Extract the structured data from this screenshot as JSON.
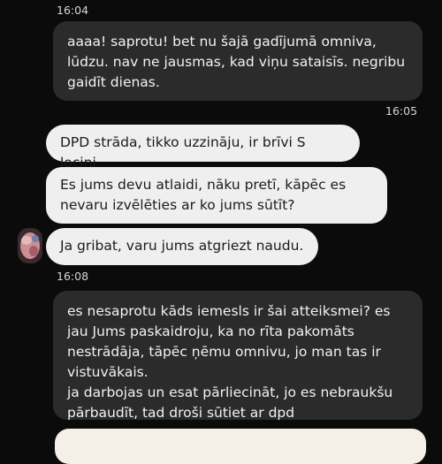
{
  "messages": [
    {
      "kind": "timestamp",
      "text": "16:04"
    },
    {
      "kind": "outgoing",
      "text": "aaaa!  saprotu! bet nu šajā gadījumā omniva,\nlūdzu. nav ne jausmas, kad viņu sataisīs. negribu\ngaidīt dienas."
    },
    {
      "kind": "timestamp",
      "text": "16:05"
    },
    {
      "kind": "incoming",
      "text": "DPD strāda, tikko uzzināju, ir brīvi S lociņi"
    },
    {
      "kind": "incoming",
      "text": "Es jums devu atlaidi, nāku pretī, kāpēc es\nnevaru izvēlēties ar ko jums sūtīt?"
    },
    {
      "kind": "incoming",
      "text": "Ja gribat, varu jums atgriezt naudu."
    },
    {
      "kind": "timestamp",
      "text": "16:08"
    },
    {
      "kind": "outgoing",
      "text": "es nesaprotu kāds iemesls ir šai atteiksmei? es\njau Jums paskaidroju, ka no rīta pakomāts\nnestrādāja, tāpēc ņēmu omnivu, jo man tas ir\nvistuvākais.\nja darbojas un esat pārliecināt, jo es nebraukšu\npārbaudīt, tad droši sūtiet ar dpd"
    }
  ]
}
